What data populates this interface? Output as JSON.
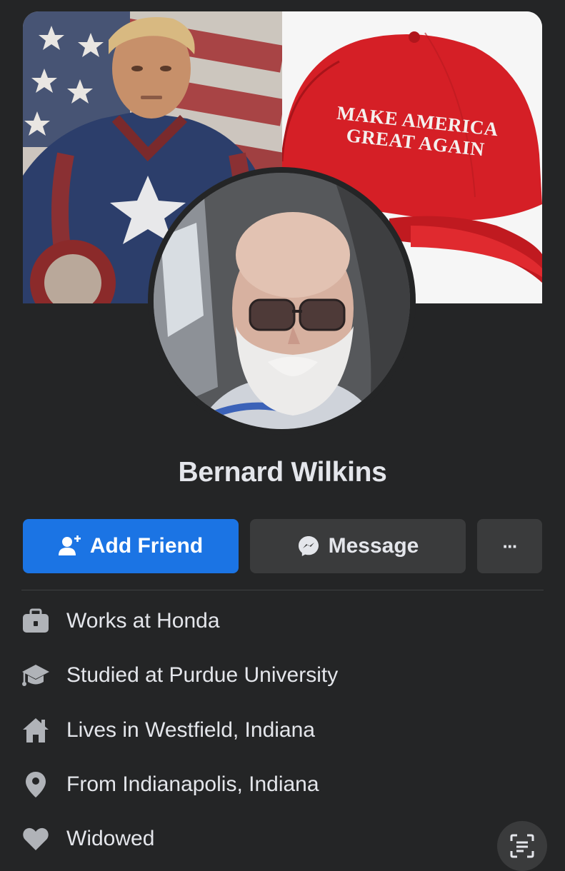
{
  "profile": {
    "name": "Bernard Wilkins"
  },
  "cover": {
    "cap_line1": "MAKE AMERICA",
    "cap_line2": "GREAT AGAIN"
  },
  "actions": {
    "add_friend": "Add Friend",
    "message": "Message",
    "more": "···"
  },
  "details": [
    {
      "icon": "briefcase-icon",
      "prefix": "Works at ",
      "value": "Honda"
    },
    {
      "icon": "graduation-cap-icon",
      "prefix": "Studied at ",
      "value": "Purdue University"
    },
    {
      "icon": "home-icon",
      "prefix": "Lives in ",
      "value": "Westfield, Indiana"
    },
    {
      "icon": "location-pin-icon",
      "prefix": "From ",
      "value": "Indianapolis, Indiana"
    },
    {
      "icon": "heart-icon",
      "prefix": "",
      "value": "Widowed"
    }
  ],
  "colors": {
    "background": "#242526",
    "primary_button": "#1b74e4",
    "secondary_button": "#3a3b3c",
    "text": "#e4e6eb",
    "icon": "#b0b3b8"
  }
}
